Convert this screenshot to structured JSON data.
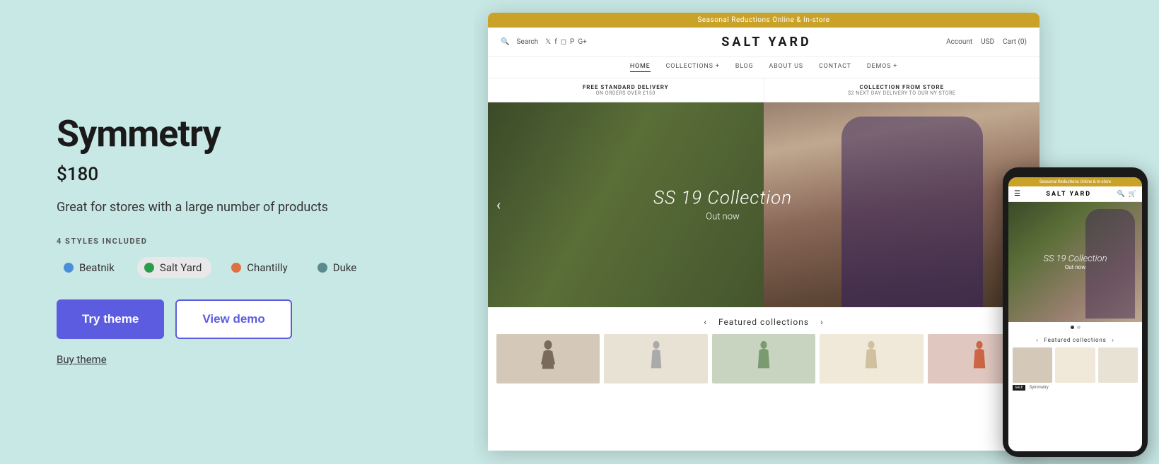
{
  "left": {
    "title": "Symmetry",
    "price": "$180",
    "description": "Great for stores with a large number of products",
    "styles_label": "4 STYLES INCLUDED",
    "styles": [
      {
        "id": "beatnik",
        "name": "Beatnik",
        "color": "#4a90d9",
        "active": false
      },
      {
        "id": "salt-yard",
        "name": "Salt Yard",
        "color": "#2a9d4a",
        "active": true
      },
      {
        "id": "chantilly",
        "name": "Chantilly",
        "color": "#e07040",
        "active": false
      },
      {
        "id": "duke",
        "name": "Duke",
        "color": "#5a8a90",
        "active": false
      }
    ],
    "try_button": "Try theme",
    "demo_button": "View demo",
    "buy_link": "Buy theme"
  },
  "store": {
    "banner": "Seasonal Reductions Online & In-store",
    "search_label": "Search",
    "logo": "SALT YARD",
    "account_label": "Account",
    "currency_label": "USD",
    "cart_label": "Cart (0)",
    "nav_items": [
      "HOME",
      "COLLECTIONS +",
      "BLOG",
      "ABOUT US",
      "CONTACT",
      "DEMOS +"
    ],
    "delivery_items": [
      {
        "title": "FREE STANDARD DELIVERY",
        "sub": "ON ORDERS OVER £150"
      },
      {
        "title": "COLLECTION FROM STORE",
        "sub": "$2 NEXT DAY DELIVERY TO OUR NY STORE"
      }
    ],
    "hero_title": "SS 19 Collection",
    "hero_subtitle": "Out now",
    "featured_label": "Featured collections"
  },
  "mobile": {
    "banner": "Seasonal Reductions Online & In-store",
    "logo": "SALT YARD",
    "hero_title": "SS 19 Collection",
    "hero_subtitle": "Out now",
    "featured_label": "Featured collections",
    "sale_label": "SALE",
    "sale_sub": "Symmetry"
  }
}
